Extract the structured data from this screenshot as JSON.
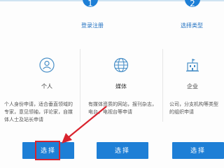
{
  "steps": [
    {
      "number": "1",
      "label": "登录注册"
    },
    {
      "number": "2",
      "label": "选择类型"
    }
  ],
  "cards": [
    {
      "icon": "person-icon",
      "title": "个人",
      "description": "个人身份申请，适合垂直领域的专家，意见领袖，评论家，自媒体人士及站长申请"
    },
    {
      "icon": "globe-icon",
      "title": "媒体",
      "description": "有媒体资质的网站，报刊杂志，电台，电视台等申请"
    },
    {
      "icon": "building-icon",
      "title": "企业",
      "description": "公司，分支机构等类型的组织申请"
    }
  ],
  "buttons": {
    "select_label": "选择"
  },
  "colors": {
    "accent": "#1e7fd6",
    "highlight": "#d9232d"
  }
}
